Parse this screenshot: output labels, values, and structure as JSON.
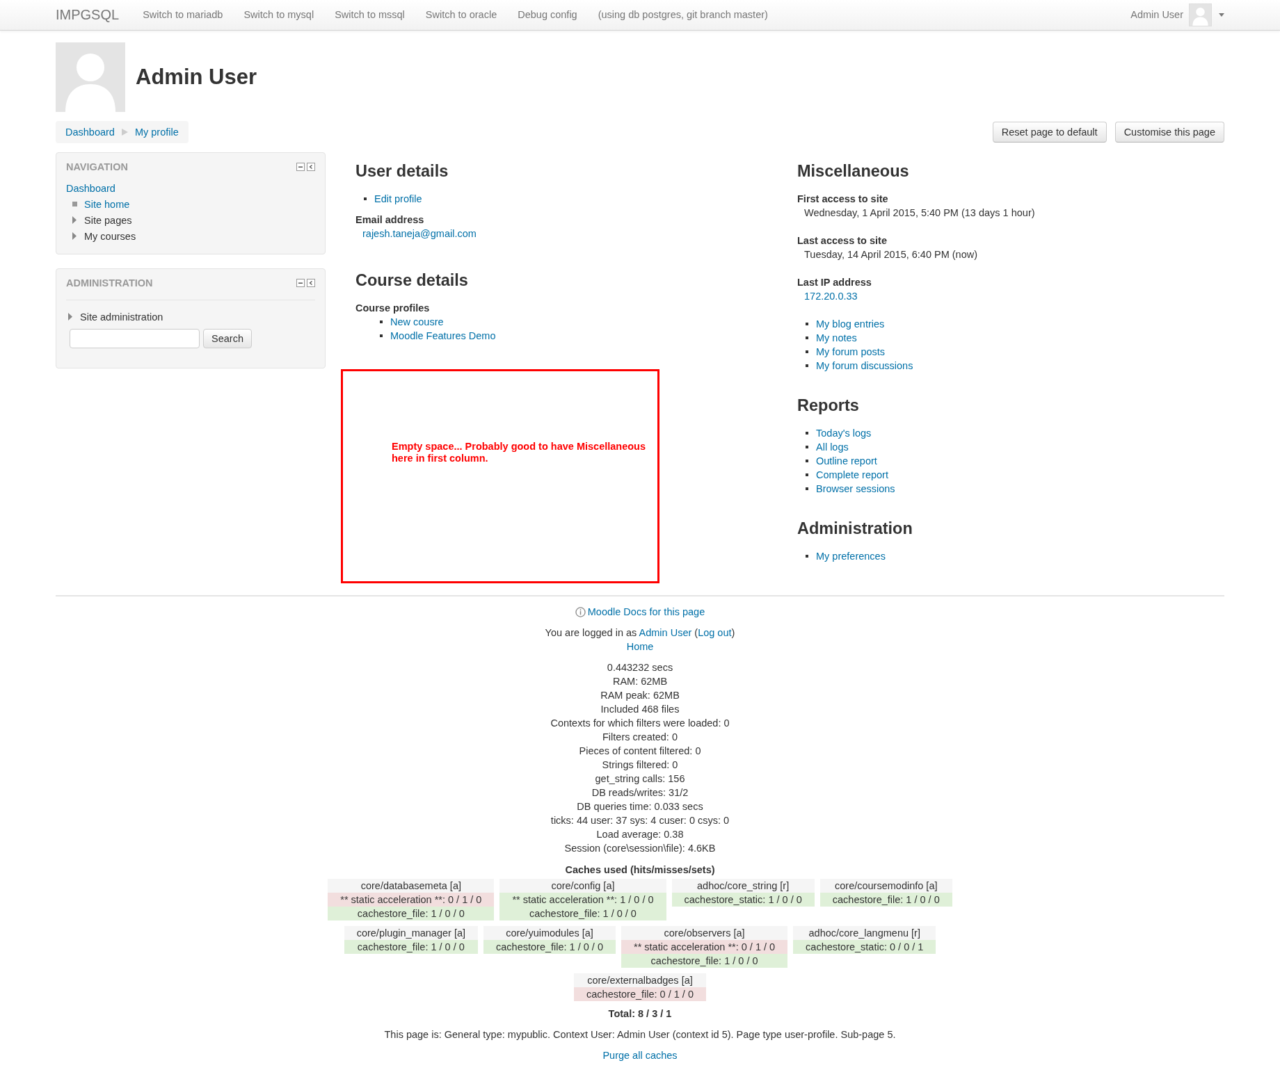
{
  "navbar": {
    "brand": "IMPGSQL",
    "links": [
      "Switch to mariadb",
      "Switch to mysql",
      "Switch to mssql",
      "Switch to oracle",
      "Debug config"
    ],
    "note": "(using db postgres, git branch master)",
    "user": "Admin User"
  },
  "header": {
    "title": "Admin User",
    "breadcrumb": [
      "Dashboard",
      "My profile"
    ],
    "buttons": [
      "Reset page to default",
      "Customise this page"
    ]
  },
  "navigation_block": {
    "title": "NAVIGATION",
    "items": [
      {
        "label": "Dashboard",
        "kind": "link",
        "children": [
          {
            "label": "Site home",
            "kind": "leaf"
          },
          {
            "label": "Site pages",
            "kind": "branch"
          },
          {
            "label": "My courses",
            "kind": "branch"
          }
        ]
      }
    ]
  },
  "administration_block": {
    "title": "ADMINISTRATION",
    "items": [
      {
        "label": "Site administration",
        "kind": "branch"
      }
    ],
    "search_button": "Search"
  },
  "user_details": {
    "title": "User details",
    "links": [
      "Edit profile"
    ],
    "fields": [
      {
        "label": "Email address",
        "value": "rajesh.taneja@gmail.com",
        "kind": "link"
      }
    ]
  },
  "course_details": {
    "title": "Course details",
    "label": "Course profiles",
    "links": [
      "New cousre",
      "Moodle Features Demo"
    ]
  },
  "annotation": {
    "text": "Empty space... Probably good to have Miscellaneous here in first column."
  },
  "miscellaneous": {
    "title": "Miscellaneous",
    "fields": [
      {
        "label": "First access to site",
        "value": "Wednesday, 1 April 2015, 5:40 PM  (13 days 1 hour)",
        "kind": "text"
      },
      {
        "label": "Last access to site",
        "value": "Tuesday, 14 April 2015, 6:40 PM  (now)",
        "kind": "text"
      },
      {
        "label": "Last IP address",
        "value": "172.20.0.33",
        "kind": "link"
      }
    ],
    "links": [
      "My blog entries",
      "My notes",
      "My forum posts",
      "My forum discussions"
    ]
  },
  "reports": {
    "title": "Reports",
    "links": [
      "Today's logs",
      "All logs",
      "Outline report",
      "Complete report",
      "Browser sessions"
    ]
  },
  "administration": {
    "title": "Administration",
    "links": [
      "My preferences"
    ]
  },
  "footer": {
    "docs_link": "Moodle Docs for this page",
    "login": {
      "prefix": "You are logged in as",
      "user": "Admin User",
      "open": "(",
      "logout": "Log out",
      "close": ")"
    },
    "home": "Home",
    "performance": [
      "0.443232 secs",
      "RAM: 62MB",
      "RAM peak: 62MB",
      "Included 468 files",
      "Contexts for which filters were loaded: 0",
      "Filters created: 0",
      "Pieces of content filtered: 0",
      "Strings filtered: 0",
      "get_string calls: 156",
      "DB reads/writes: 31/2",
      "DB queries time: 0.033 secs",
      "ticks: 44 user: 37 sys: 4 cuser: 0 csys: 0",
      "Load average: 0.38",
      "Session (core\\session\\file): 4.6KB"
    ],
    "caches_title": "Caches used (hits/misses/sets)",
    "cache_rows": [
      [
        {
          "name": "core/databasemeta [a]",
          "stores": [
            {
              "text": "** static acceleration **: 0 / 1 / 0",
              "color": "#f2dede"
            },
            {
              "text": "cachestore_file: 1 / 0 / 0",
              "color": "#dff0d8"
            }
          ]
        },
        {
          "name": "core/config [a]",
          "stores": [
            {
              "text": "** static acceleration **: 1 / 0 / 0",
              "color": "#dff0d8"
            },
            {
              "text": "cachestore_file: 1 / 0 / 0",
              "color": "#dff0d8"
            }
          ]
        },
        {
          "name": "adhoc/core_string [r]",
          "stores": [
            {
              "text": "cachestore_static: 1 / 0 / 0",
              "color": "#dff0d8"
            }
          ]
        },
        {
          "name": "core/coursemodinfo [a]",
          "stores": [
            {
              "text": "cachestore_file: 1 / 0 / 0",
              "color": "#dff0d8"
            }
          ]
        }
      ],
      [
        {
          "name": "core/plugin_manager [a]",
          "stores": [
            {
              "text": "cachestore_file: 1 / 0 / 0",
              "color": "#dff0d8"
            }
          ]
        },
        {
          "name": "core/yuimodules [a]",
          "stores": [
            {
              "text": "cachestore_file: 1 / 0 / 0",
              "color": "#dff0d8"
            }
          ]
        },
        {
          "name": "core/observers [a]",
          "stores": [
            {
              "text": "** static acceleration **: 0 / 1 / 0",
              "color": "#f2dede"
            },
            {
              "text": "cachestore_file: 1 / 0 / 0",
              "color": "#dff0d8"
            }
          ]
        },
        {
          "name": "adhoc/core_langmenu [r]",
          "stores": [
            {
              "text": "cachestore_static: 0 / 0 / 1",
              "color": "#dff0d8"
            }
          ]
        }
      ],
      [
        {
          "name": "core/externalbadges [a]",
          "stores": [
            {
              "text": "cachestore_file: 0 / 1 / 0",
              "color": "#f2dede"
            }
          ]
        }
      ]
    ],
    "total": "Total: 8 / 3 / 1",
    "page_info": "This page is: General type: mypublic. Context User: Admin User (context id 5). Page type user-profile. Sub-page 5.",
    "purge_link": "Purge all caches"
  }
}
